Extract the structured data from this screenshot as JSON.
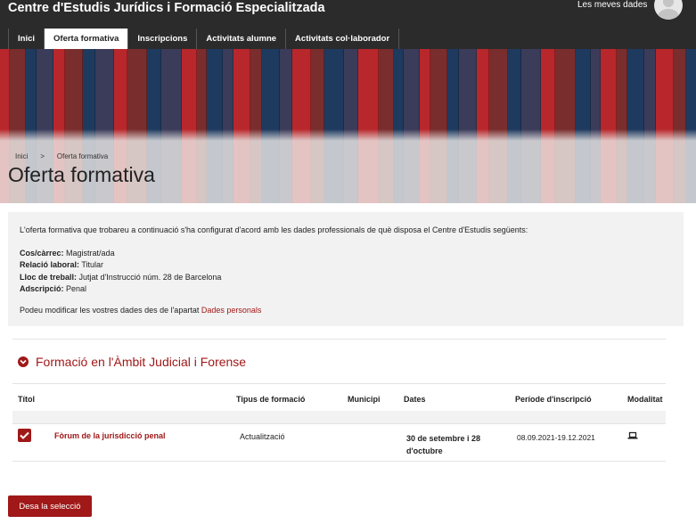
{
  "header": {
    "site_title": "Centre d'Estudis Jurídics i Formació Especialitzada",
    "user_link": "Les meves dades"
  },
  "nav": [
    {
      "label": "Inici",
      "active": false
    },
    {
      "label": "Oferta formativa",
      "active": true
    },
    {
      "label": "Inscripcions",
      "active": false
    },
    {
      "label": "Activitats alumne",
      "active": false
    },
    {
      "label": "Activitats col·laborador",
      "active": false
    }
  ],
  "breadcrumb": {
    "home": "Inici",
    "separator": ">",
    "current": "Oferta formativa"
  },
  "page_title": "Oferta formativa",
  "info": {
    "intro": "L'oferta formativa que trobareu a continuació s'ha configurat d'acord amb les dades professionals de què disposa el Centre d'Estudis següents:",
    "fields": [
      {
        "label": "Cos/càrrec:",
        "value": "Magistrat/ada"
      },
      {
        "label": "Relació laboral:",
        "value": "Titular"
      },
      {
        "label": "Lloc de treball:",
        "value": "Jutjat d'Instrucció núm. 28 de Barcelona"
      },
      {
        "label": "Adscripció:",
        "value": "Penal"
      }
    ],
    "note_prefix": "Podeu modificar les vostres dades des de l'apartat",
    "note_link": "Dades personals"
  },
  "section": {
    "title": "Formació en l'Àmbit Judicial i Forense"
  },
  "table": {
    "headers": {
      "titol": "Títol",
      "tipus": "Tipus de formació",
      "municipi": "Municipi",
      "dates": "Dates",
      "periode": "Període d'inscripció",
      "modalitat": "Modalitat"
    },
    "rows": [
      {
        "checked": true,
        "titol": "Fòrum de la jurisdicció penal",
        "tipus": "Actualització",
        "municipi": "",
        "dates_line1": "30 de setembre i 28",
        "dates_line2": "d'octubre",
        "periode": "08.09.2021-19.12.2021",
        "modalitat_icon": "laptop-icon"
      }
    ]
  },
  "button": {
    "label": "Desa la selecció"
  },
  "colors": {
    "accent": "#a01818",
    "topbar": "#2b2b2b",
    "panel": "#f2f2f2"
  }
}
